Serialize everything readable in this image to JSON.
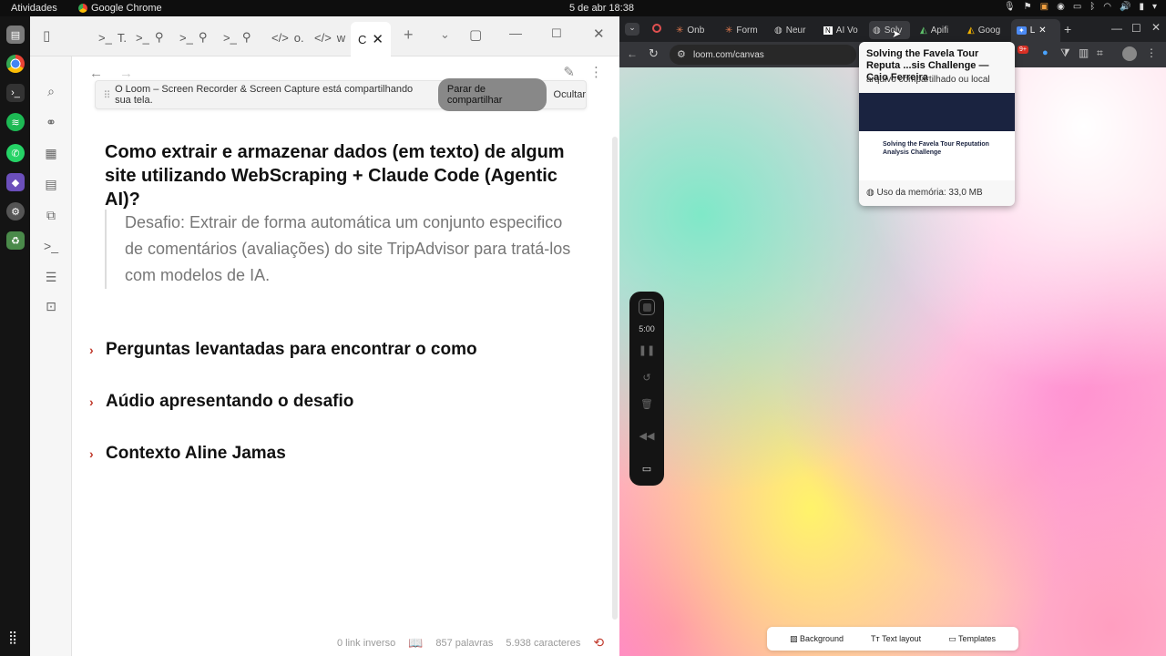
{
  "topbar": {
    "activities": "Atividades",
    "app_name": "Google Chrome",
    "clock": "5 de abr  18:38"
  },
  "obsidian": {
    "tabs": [
      "T.",
      "o.",
      "w",
      "C"
    ],
    "share_banner": {
      "message": "O Loom – Screen Recorder & Screen Capture está compartilhando sua tela.",
      "stop_label": "Parar de compartilhar",
      "hide_label": "Ocultar"
    },
    "heading": "Como extrair e armazenar dados (em texto) de algum site utilizando WebScraping + Claude Code (Agentic AI)?",
    "quote": "Desafio: Extrair de forma automática um conjunto especifico de comentários (avaliações) do site TripAdvisor para tratá-los com modelos de IA.",
    "sections": [
      {
        "label": "Perguntas levantadas para encontrar o como"
      },
      {
        "label": "Aúdio apresentando o desafio"
      },
      {
        "label": "Contexto Aline Jamas"
      }
    ],
    "status": {
      "backlinks": "0 link inverso",
      "words": "857 palavras",
      "chars": "5.938 caracteres"
    }
  },
  "chrome": {
    "tabs": [
      "Onb",
      "Form",
      "Neur",
      "AI Vo",
      "Solv",
      "Apifi",
      "Goog",
      "L"
    ],
    "url": "loom.com/canvas",
    "recorder": {
      "timer": "5:00"
    },
    "bottom_toolbar": {
      "background": "Background",
      "text_layout": "Text layout",
      "templates": "Templates"
    },
    "tab_preview": {
      "title": "Solving the Favela Tour Reputa ...sis Challenge — Caio Ferreira",
      "subtitle": "arquivo compartilhado ou local",
      "thumb_title": "Solving the Favela Tour Reputation Analysis Challenge",
      "memory": "Uso da memória: 33,0 MB"
    },
    "badge": "9+"
  }
}
